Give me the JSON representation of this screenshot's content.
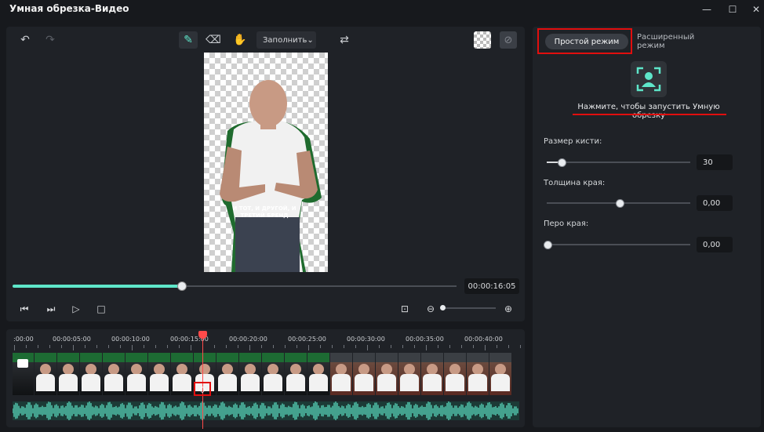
{
  "window": {
    "title": "Умная обрезка-Видео"
  },
  "toolbar": {
    "fill_label": "Заполнить"
  },
  "preview": {
    "caption": "И ТОТ, И ДРУГОЙ, И ТРЕТИЙ БРЕНД"
  },
  "playback": {
    "timecode": "00:00:16:05",
    "progress": 0.38
  },
  "timeline": {
    "ruler": [
      ":00:00",
      "00:00:05:00",
      "00:00:10:00",
      "00:00:15:00",
      "00:00:20:00",
      "00:00:25:00",
      "00:00:30:00",
      "00:00:35:00",
      "00:00:40:00"
    ]
  },
  "panel": {
    "mode_simple": "Простой режим",
    "mode_advanced": "Расширенный режим",
    "smart_hint": "Нажмите, чтобы запустить Умную обрезку",
    "brush_label": "Размер кисти:",
    "brush_value": "30",
    "brush_level": 0.1,
    "edge_thickness_label": "Толщина края:",
    "edge_thickness_value": "0,00",
    "edge_thickness_level": 0.5,
    "edge_feather_label": "Перо края:",
    "edge_feather_value": "0,00",
    "edge_feather_level": 0.0
  },
  "colors": {
    "accent": "#5ee6c9",
    "highlight": "#e10e0e"
  }
}
